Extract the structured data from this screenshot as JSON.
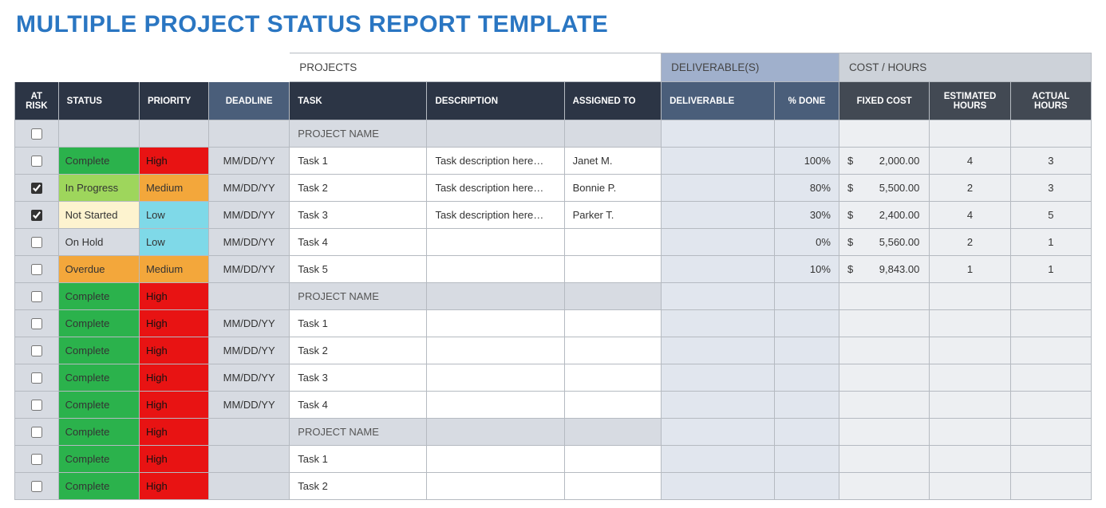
{
  "title": "MULTIPLE PROJECT STATUS REPORT TEMPLATE",
  "group_headers": {
    "projects": "PROJECTS",
    "deliverables": "DELIVERABLE(S)",
    "cost_hours": "COST / HOURS"
  },
  "headers": {
    "at_risk": "AT RISK",
    "status": "STATUS",
    "priority": "PRIORITY",
    "deadline": "DEADLINE",
    "task": "TASK",
    "description": "DESCRIPTION",
    "assigned_to": "ASSIGNED TO",
    "deliverable": "DELIVERABLE",
    "pct_done": "% DONE",
    "fixed_cost": "FIXED COST",
    "est_hours": "ESTIMATED HOURS",
    "act_hours": "ACTUAL HOURS"
  },
  "status_classes": {
    "Complete": "complete",
    "In Progress": "in-progress",
    "Not Started": "not-started",
    "On Hold": "on-hold",
    "Overdue": "overdue"
  },
  "priority_classes": {
    "High": "high",
    "Medium": "medium",
    "Low": "low"
  },
  "rows": [
    {
      "section": true,
      "at_risk": false,
      "status": "",
      "priority": "",
      "deadline": "",
      "task": "PROJECT NAME",
      "description": "",
      "assigned_to": "",
      "deliverable": "",
      "pct_done": "",
      "fixed_cost": "",
      "est_hours": "",
      "act_hours": ""
    },
    {
      "section": false,
      "at_risk": false,
      "status": "Complete",
      "priority": "High",
      "deadline": "MM/DD/YY",
      "task": "Task 1",
      "description": "Task description here…",
      "assigned_to": "Janet M.",
      "pct_done": "100%",
      "fixed_cost": "2,000.00",
      "est_hours": "4",
      "act_hours": "3"
    },
    {
      "section": false,
      "at_risk": true,
      "status": "In Progress",
      "priority": "Medium",
      "deadline": "MM/DD/YY",
      "task": "Task 2",
      "description": "Task description here…",
      "assigned_to": "Bonnie P.",
      "pct_done": "80%",
      "fixed_cost": "5,500.00",
      "est_hours": "2",
      "act_hours": "3"
    },
    {
      "section": false,
      "at_risk": true,
      "status": "Not Started",
      "priority": "Low",
      "deadline": "MM/DD/YY",
      "task": "Task 3",
      "description": "Task description here…",
      "assigned_to": "Parker T.",
      "pct_done": "30%",
      "fixed_cost": "2,400.00",
      "est_hours": "4",
      "act_hours": "5"
    },
    {
      "section": false,
      "at_risk": false,
      "status": "On Hold",
      "priority": "Low",
      "deadline": "MM/DD/YY",
      "task": "Task 4",
      "description": "",
      "assigned_to": "",
      "pct_done": "0%",
      "fixed_cost": "5,560.00",
      "est_hours": "2",
      "act_hours": "1"
    },
    {
      "section": false,
      "at_risk": false,
      "status": "Overdue",
      "priority": "Medium",
      "deadline": "MM/DD/YY",
      "task": "Task 5",
      "description": "",
      "assigned_to": "",
      "pct_done": "10%",
      "fixed_cost": "9,843.00",
      "est_hours": "1",
      "act_hours": "1"
    },
    {
      "section": true,
      "at_risk": false,
      "status": "Complete",
      "priority": "High",
      "deadline": "",
      "task": "PROJECT NAME",
      "description": "",
      "assigned_to": "",
      "pct_done": "",
      "fixed_cost": "",
      "est_hours": "",
      "act_hours": ""
    },
    {
      "section": false,
      "at_risk": false,
      "status": "Complete",
      "priority": "High",
      "deadline": "MM/DD/YY",
      "task": "Task 1",
      "description": "",
      "assigned_to": "",
      "pct_done": "",
      "fixed_cost": "",
      "est_hours": "",
      "act_hours": ""
    },
    {
      "section": false,
      "at_risk": false,
      "status": "Complete",
      "priority": "High",
      "deadline": "MM/DD/YY",
      "task": "Task 2",
      "description": "",
      "assigned_to": "",
      "pct_done": "",
      "fixed_cost": "",
      "est_hours": "",
      "act_hours": ""
    },
    {
      "section": false,
      "at_risk": false,
      "status": "Complete",
      "priority": "High",
      "deadline": "MM/DD/YY",
      "task": "Task 3",
      "description": "",
      "assigned_to": "",
      "pct_done": "",
      "fixed_cost": "",
      "est_hours": "",
      "act_hours": ""
    },
    {
      "section": false,
      "at_risk": false,
      "status": "Complete",
      "priority": "High",
      "deadline": "MM/DD/YY",
      "task": "Task 4",
      "description": "",
      "assigned_to": "",
      "pct_done": "",
      "fixed_cost": "",
      "est_hours": "",
      "act_hours": ""
    },
    {
      "section": true,
      "at_risk": false,
      "status": "Complete",
      "priority": "High",
      "deadline": "",
      "task": "PROJECT NAME",
      "description": "",
      "assigned_to": "",
      "pct_done": "",
      "fixed_cost": "",
      "est_hours": "",
      "act_hours": ""
    },
    {
      "section": false,
      "at_risk": false,
      "status": "Complete",
      "priority": "High",
      "deadline": "",
      "task": "Task 1",
      "description": "",
      "assigned_to": "",
      "pct_done": "",
      "fixed_cost": "",
      "est_hours": "",
      "act_hours": ""
    },
    {
      "section": false,
      "at_risk": false,
      "status": "Complete",
      "priority": "High",
      "deadline": "",
      "task": "Task 2",
      "description": "",
      "assigned_to": "",
      "pct_done": "",
      "fixed_cost": "",
      "est_hours": "",
      "act_hours": ""
    }
  ]
}
